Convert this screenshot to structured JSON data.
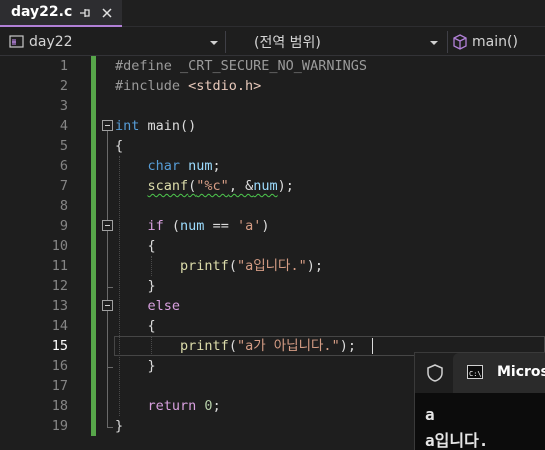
{
  "tab": {
    "title": "day22.c"
  },
  "navbar": {
    "project": "day22",
    "scope": "(전역 범위)",
    "function": "main()"
  },
  "editor": {
    "current_line": 15,
    "lines": [
      {
        "n": "1",
        "tokens": [
          [
            "pp",
            "#define _CRT_SECURE_NO_WARNINGS"
          ]
        ]
      },
      {
        "n": "2",
        "tokens": [
          [
            "pp",
            "#include "
          ],
          [
            "inc",
            "<stdio.h>"
          ]
        ]
      },
      {
        "n": "3",
        "tokens": []
      },
      {
        "n": "4",
        "tokens": [
          [
            "kw",
            "int "
          ],
          [
            "plain",
            "main()"
          ]
        ]
      },
      {
        "n": "5",
        "tokens": [
          [
            "plain",
            "{"
          ]
        ]
      },
      {
        "n": "6",
        "tokens": [
          [
            "plain",
            "    "
          ],
          [
            "kw",
            "char "
          ],
          [
            "var",
            "num"
          ],
          [
            "plain",
            ";"
          ]
        ]
      },
      {
        "n": "7",
        "tokens": [
          [
            "plain",
            "    "
          ],
          [
            "fn squig",
            "scanf"
          ],
          [
            "plain squig",
            "("
          ],
          [
            "str squig",
            "\"%c\""
          ],
          [
            "plain squig",
            ", &"
          ],
          [
            "var squig",
            "num"
          ],
          [
            "plain",
            ");"
          ]
        ]
      },
      {
        "n": "8",
        "tokens": []
      },
      {
        "n": "9",
        "tokens": [
          [
            "plain",
            "    "
          ],
          [
            "ctrl",
            "if "
          ],
          [
            "plain",
            "("
          ],
          [
            "var",
            "num"
          ],
          [
            "plain",
            " == "
          ],
          [
            "str",
            "'a'"
          ],
          [
            "plain",
            ")"
          ]
        ]
      },
      {
        "n": "10",
        "tokens": [
          [
            "plain",
            "    {"
          ]
        ]
      },
      {
        "n": "11",
        "tokens": [
          [
            "plain",
            "        "
          ],
          [
            "fn",
            "printf"
          ],
          [
            "plain",
            "("
          ],
          [
            "str",
            "\"a입니다.\""
          ],
          [
            "plain",
            ");"
          ]
        ]
      },
      {
        "n": "12",
        "tokens": [
          [
            "plain",
            "    }"
          ]
        ]
      },
      {
        "n": "13",
        "tokens": [
          [
            "plain",
            "    "
          ],
          [
            "ctrl",
            "else"
          ]
        ]
      },
      {
        "n": "14",
        "tokens": [
          [
            "plain",
            "    {"
          ]
        ]
      },
      {
        "n": "15",
        "tokens": [
          [
            "plain",
            "        "
          ],
          [
            "fn",
            "printf"
          ],
          [
            "plain",
            "("
          ],
          [
            "str",
            "\"a가 아닙니다.\""
          ],
          [
            "plain",
            ");"
          ]
        ]
      },
      {
        "n": "16",
        "tokens": [
          [
            "plain",
            "    }"
          ]
        ]
      },
      {
        "n": "17",
        "tokens": []
      },
      {
        "n": "18",
        "tokens": [
          [
            "plain",
            "    "
          ],
          [
            "ctrl",
            "return "
          ],
          [
            "num",
            "0"
          ],
          [
            "plain",
            ";"
          ]
        ]
      },
      {
        "n": "19",
        "tokens": [
          [
            "plain",
            "}"
          ]
        ]
      }
    ]
  },
  "console": {
    "title": "Microsoft",
    "output": [
      "a",
      "a입니다."
    ]
  },
  "colors": {
    "accent_tab": "#b180d7",
    "change_bar": "#57a64a",
    "keyword": "#569cd6",
    "control": "#d8a0df",
    "string": "#d69d85",
    "function": "#dcdcaa"
  }
}
